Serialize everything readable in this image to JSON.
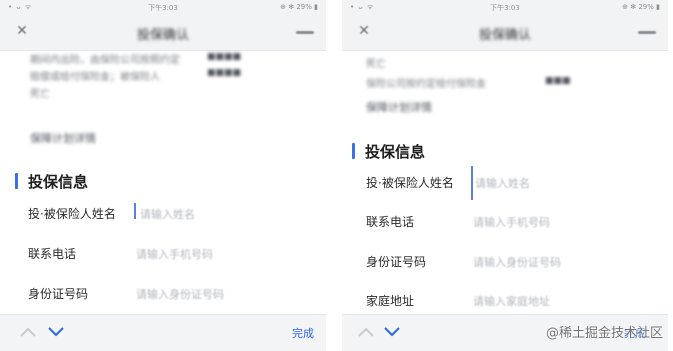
{
  "left": {
    "status": {
      "left": "• ᴗ ᯤ",
      "time": "下午3:03",
      "right": "⊕ ✻ 29% ▮"
    },
    "header": {
      "close_icon": "close-icon",
      "title": "投保确认",
      "more_icon": "more-icon"
    },
    "blurred_text": [
      "期间内出险，由保险公司按照约定",
      "赔偿或给付保险金；被保险人",
      "死亡",
      "保障计划详情"
    ],
    "section_title": "投保信息",
    "fields": [
      {
        "label": "投·被保险人姓名",
        "placeholder": "请输入姓名"
      },
      {
        "label": "联系电话",
        "placeholder": "请输入手机号码"
      },
      {
        "label": "身份证号码",
        "placeholder": "请输入身份证号码"
      }
    ],
    "keyboard_toolbar": {
      "done_label": "完成"
    }
  },
  "right": {
    "status": {
      "left": "• ᴗ ᯤ",
      "time": "下午3:03",
      "right": "⊕ ✻ 29% ▮"
    },
    "header": {
      "close_icon": "close-icon",
      "title": "投保确认",
      "more_icon": "more-icon"
    },
    "blurred_text": [
      "死亡",
      "保险公司按约定给付保险金",
      "保障计划详情"
    ],
    "section_title": "投保信息",
    "fields": [
      {
        "label": "投·被保险人姓名",
        "placeholder": "请输入姓名"
      },
      {
        "label": "联系电话",
        "placeholder": "请输入手机号码"
      },
      {
        "label": "身份证号码",
        "placeholder": "请输入身份证号码"
      },
      {
        "label": "家庭地址",
        "placeholder": "请输入家庭地址"
      }
    ],
    "keyboard_toolbar": {
      "done_label": "完成"
    }
  },
  "watermark": "@稀土掘金技术社区",
  "colors": {
    "accent": "#3d6fe8",
    "done": "#2f64e0",
    "caret": "#5b7fe0"
  }
}
